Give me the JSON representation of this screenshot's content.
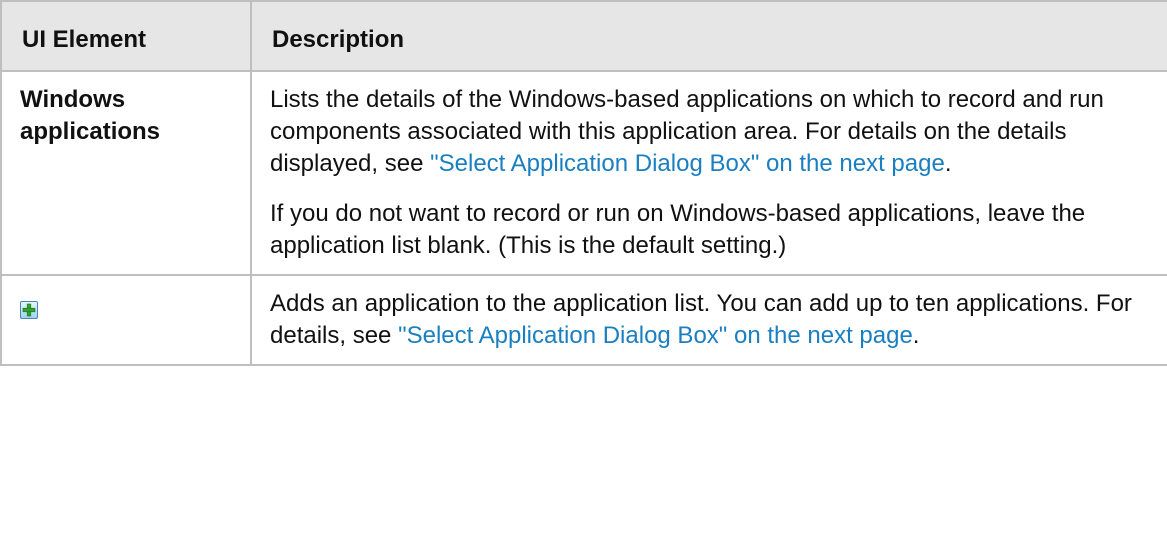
{
  "table": {
    "headers": {
      "col1": "UI Element",
      "col2": "Description"
    },
    "rows": [
      {
        "element_label": "Windows applications",
        "paragraphs": [
          {
            "pre": "Lists the details of the Windows-based applications on which to record and run components associated with this application area. For details on the details displayed, see ",
            "link": "\"Select Application Dialog Box\" on the next page",
            "post": "."
          },
          {
            "pre": "If you do not want to record or run on Windows-based applications, leave the application list blank. (This is the default setting.)"
          }
        ]
      },
      {
        "element_icon": "add-plus-icon",
        "paragraphs": [
          {
            "pre": "Adds an application to the application list. You can add up to ten applications. For details, see ",
            "link": "\"Select Application Dialog Box\" on the next page",
            "post": "."
          }
        ]
      }
    ]
  },
  "colors": {
    "link": "#1a7fc0",
    "header_bg": "#e6e6e6",
    "border": "#bfbfbf",
    "icon_green": "#2fa52f"
  }
}
